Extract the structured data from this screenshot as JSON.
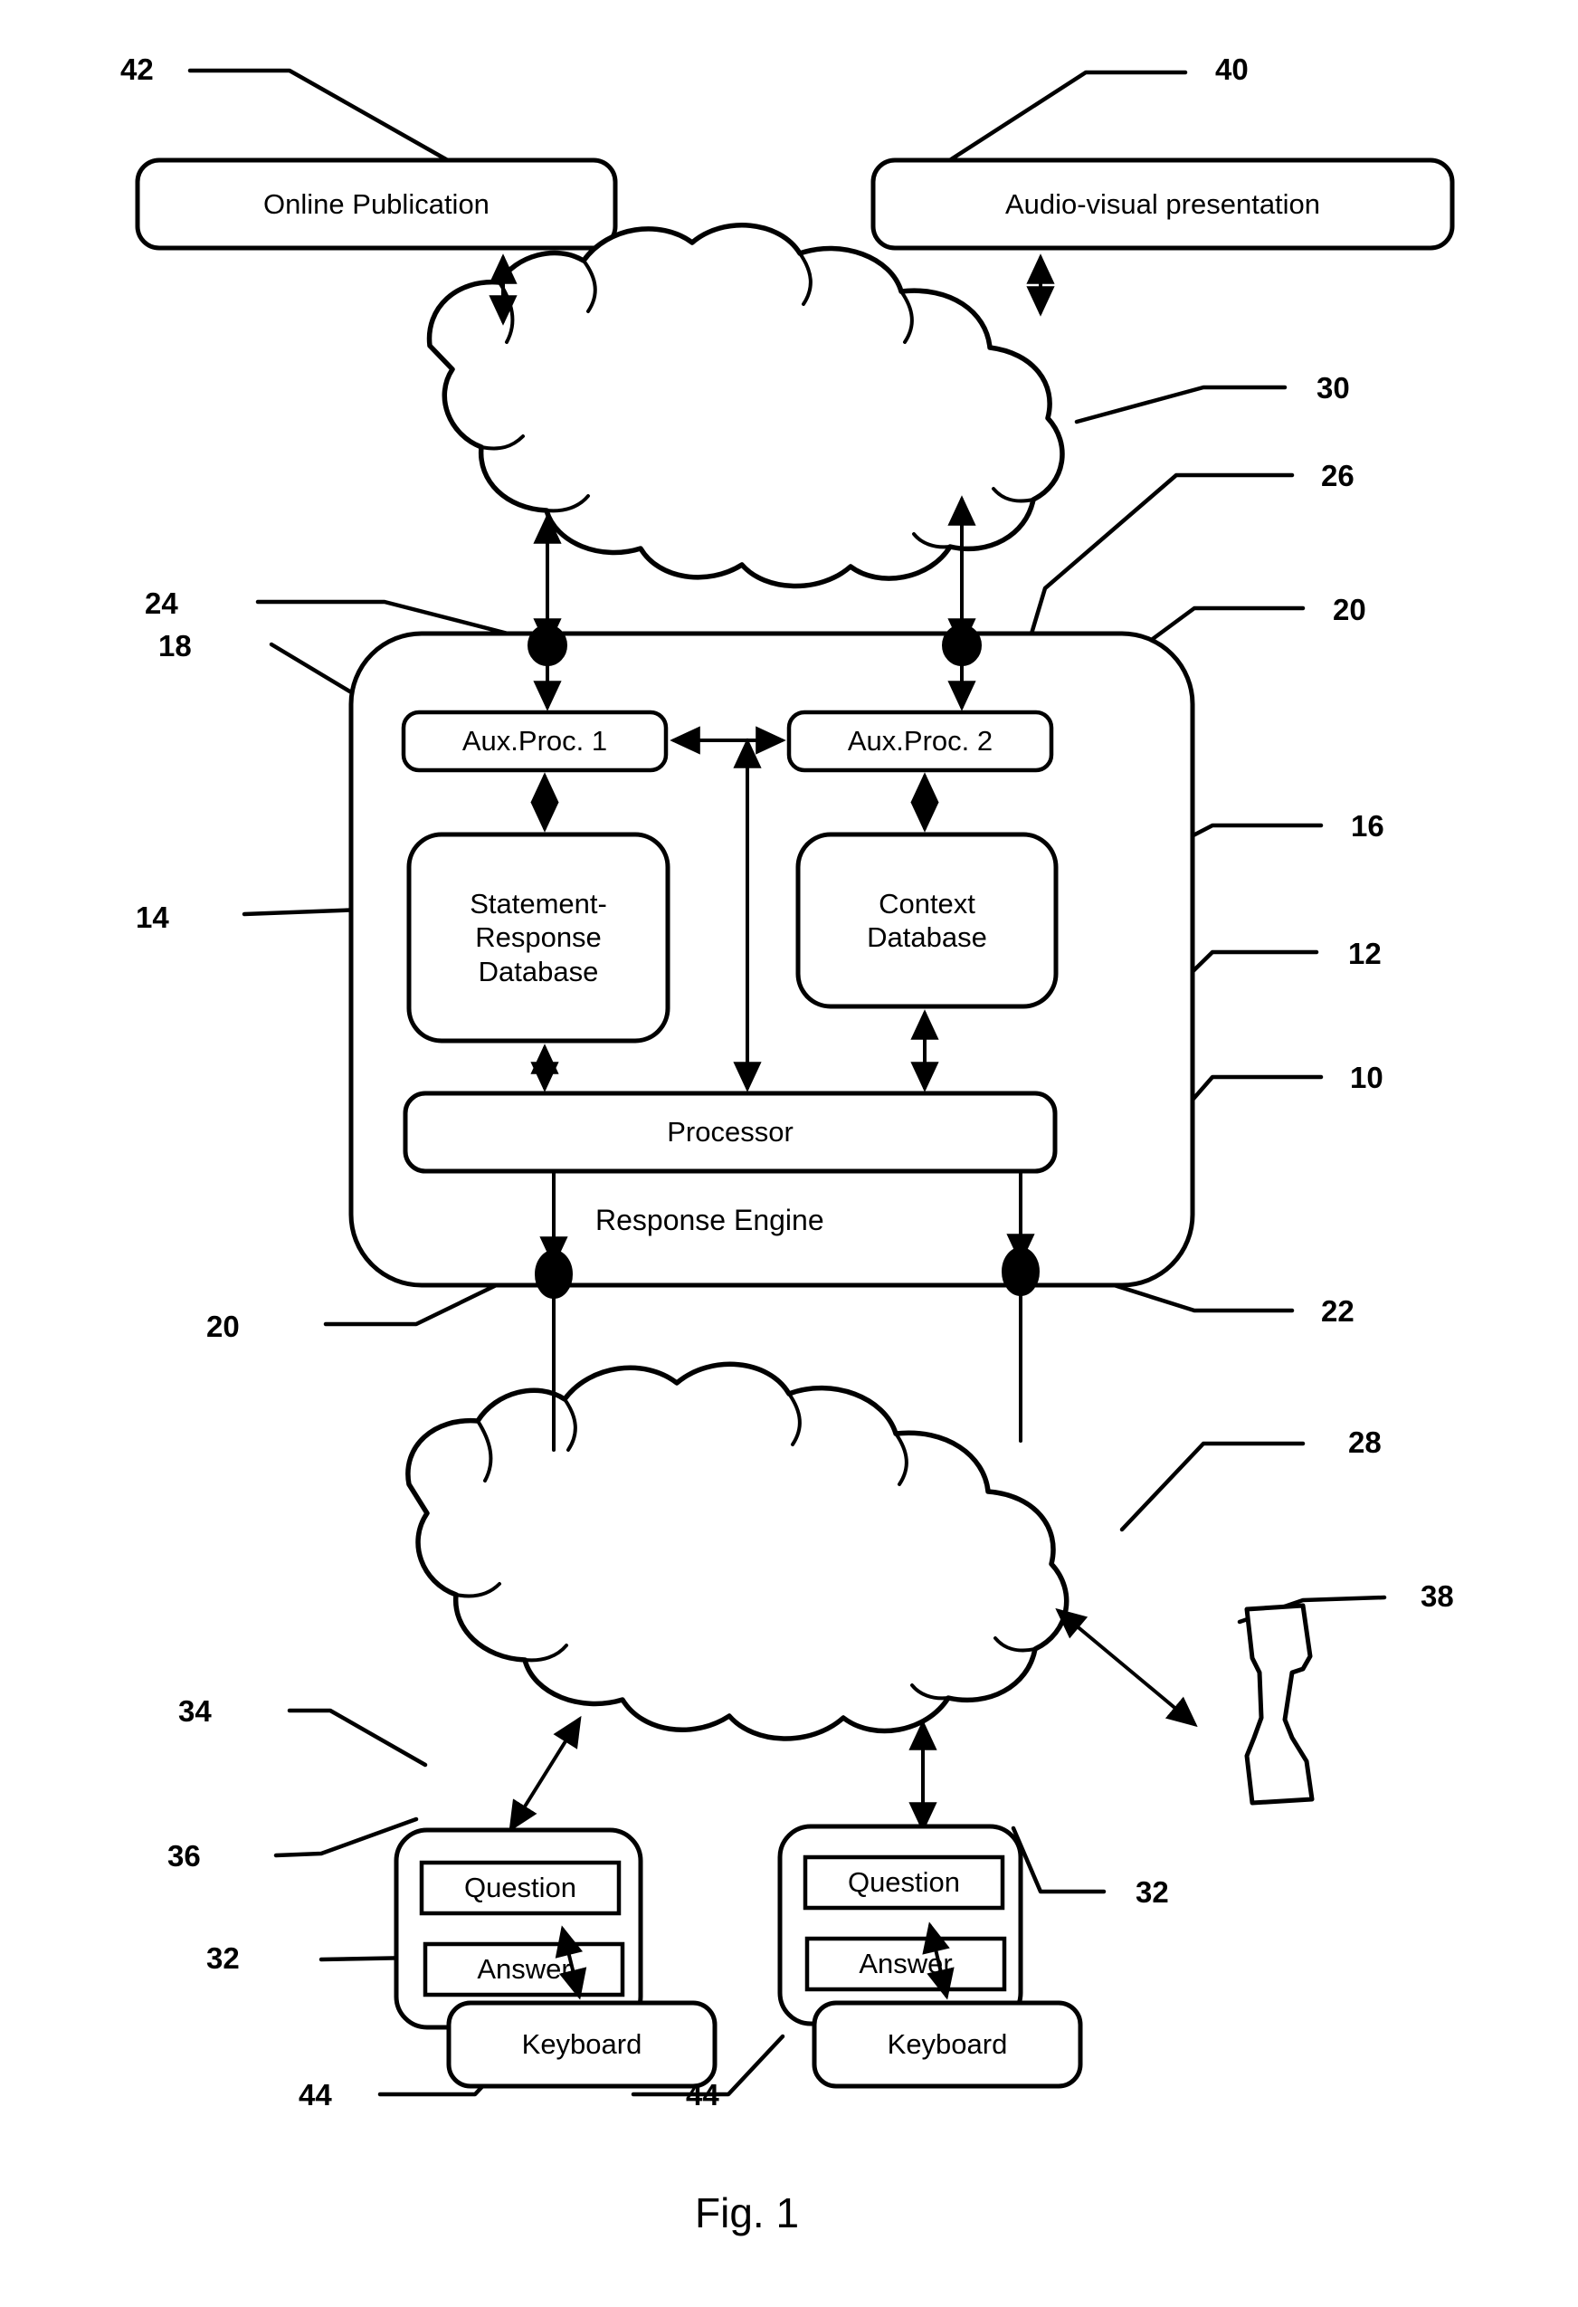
{
  "figure": {
    "caption": "Fig. 1"
  },
  "nodes": {
    "online_publication": "Online Publication",
    "audio_visual": "Audio-visual presentation",
    "aux_proc_1": "Aux.Proc. 1",
    "aux_proc_2": "Aux.Proc. 2",
    "statement_response_db": "Statement-\nResponse\nDatabase",
    "statement_response_db_line1": "Statement-",
    "statement_response_db_line2": "Response",
    "statement_response_db_line3": "Database",
    "context_db_line1": "Context",
    "context_db_line2": "Database",
    "processor": "Processor",
    "response_engine": "Response Engine",
    "question_left": "Question",
    "answer_left": "Answer",
    "question_right": "Question",
    "answer_right": "Answer",
    "keyboard_left": "Keyboard",
    "keyboard_right": "Keyboard"
  },
  "reference_numerals": {
    "n42": "42",
    "n40": "40",
    "n30": "30",
    "n24": "24",
    "n26": "26",
    "n18": "18",
    "n20_top": "20",
    "n16": "16",
    "n14": "14",
    "n12": "12",
    "n10": "10",
    "n20_bottom": "20",
    "n22": "22",
    "n28": "28",
    "n38": "38",
    "n34": "34",
    "n36": "36",
    "n32_left": "32",
    "n32_right": "32",
    "n44_left": "44",
    "n44_right": "44"
  },
  "icons": {
    "cloud_network_top": "cloud-icon",
    "cloud_network_bottom": "cloud-icon",
    "telephone_handset": "telephone-handset-icon",
    "connector_node": "connection-node-icon"
  },
  "colors": {
    "ink": "#000000",
    "paper": "#ffffff"
  }
}
